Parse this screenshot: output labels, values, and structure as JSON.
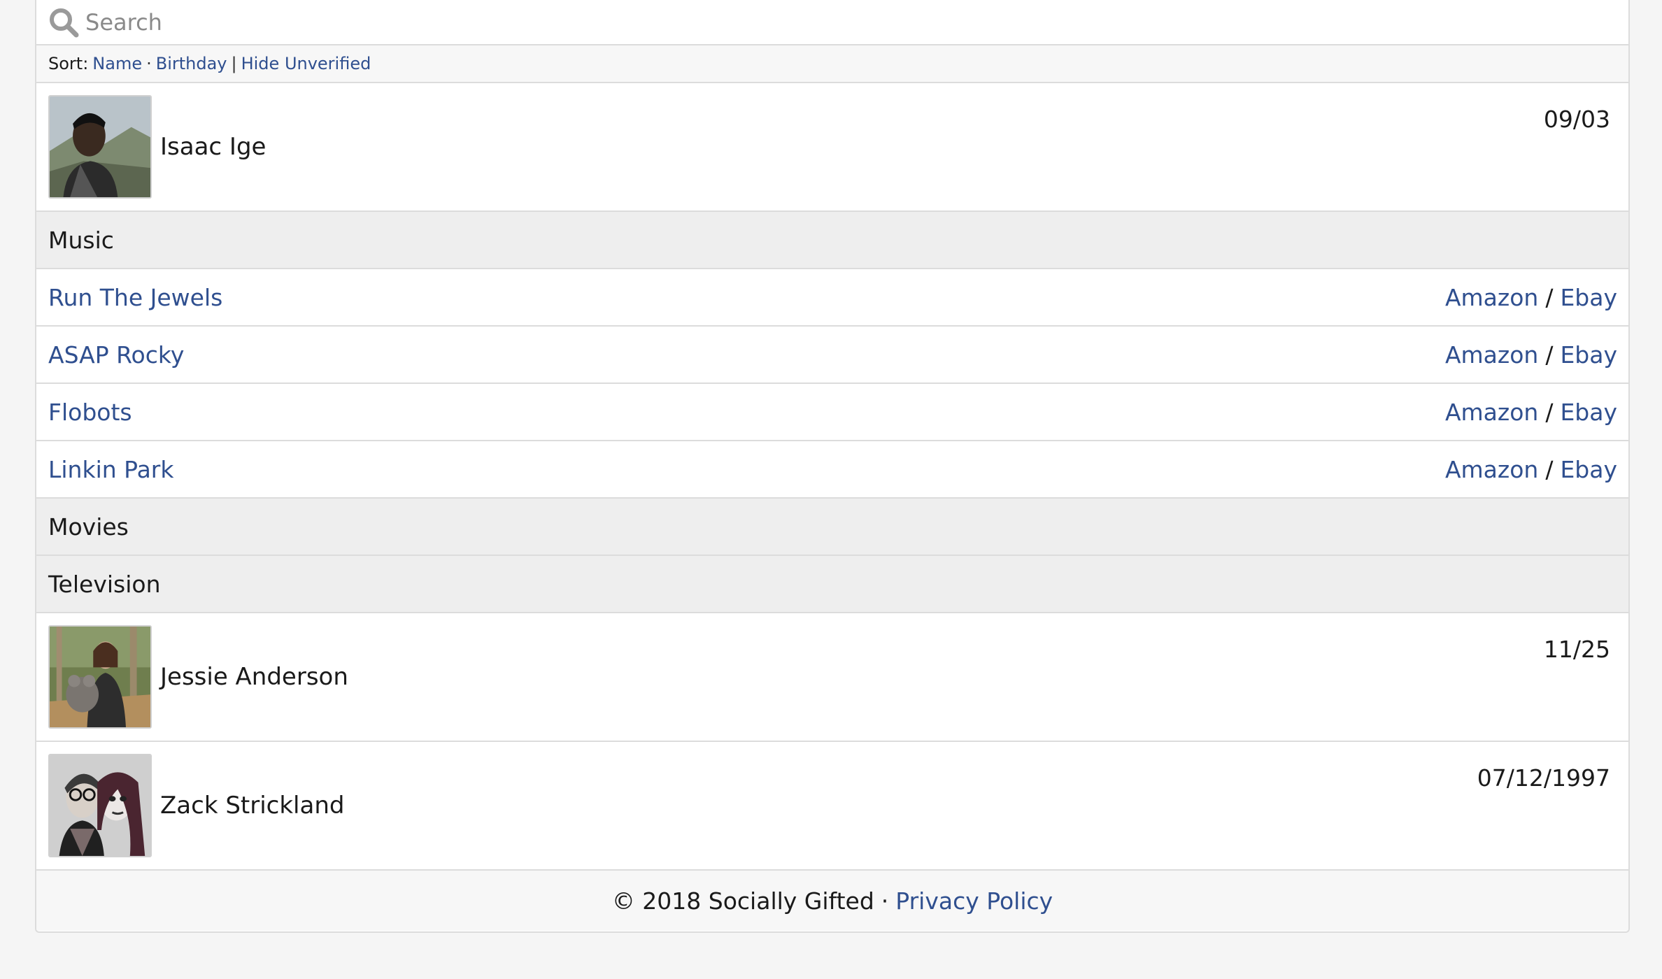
{
  "search": {
    "placeholder": "Search"
  },
  "sort": {
    "label": "Sort:",
    "name_label": "Name",
    "dot": "·",
    "birthday_label": "Birthday",
    "bar": "|",
    "hide_unverified_label": "Hide Unverified"
  },
  "people": [
    {
      "name": "Isaac Ige",
      "date": "09/03",
      "avatar": "person-photo"
    },
    {
      "name": "Jessie Anderson",
      "date": "11/25",
      "avatar": "person-with-koala-photo"
    },
    {
      "name": "Zack Strickland",
      "date": "07/12/1997",
      "avatar": "couple-photo"
    }
  ],
  "categories": {
    "music": "Music",
    "movies": "Movies",
    "television": "Television"
  },
  "music_items": [
    {
      "name": "Run The Jewels",
      "amazon": "Amazon",
      "slash": "/",
      "ebay": "Ebay"
    },
    {
      "name": "ASAP Rocky",
      "amazon": "Amazon",
      "slash": "/",
      "ebay": "Ebay"
    },
    {
      "name": "Flobots",
      "amazon": "Amazon",
      "slash": "/",
      "ebay": "Ebay"
    },
    {
      "name": "Linkin Park",
      "amazon": "Amazon",
      "slash": "/",
      "ebay": "Ebay"
    }
  ],
  "footer": {
    "copyright": "© 2018 Socially Gifted",
    "dot": "·",
    "privacy_label": "Privacy Policy"
  },
  "colors": {
    "link": "#2f4f8f",
    "category_bg": "#eeeeee",
    "page_bg": "#f5f5f5"
  }
}
